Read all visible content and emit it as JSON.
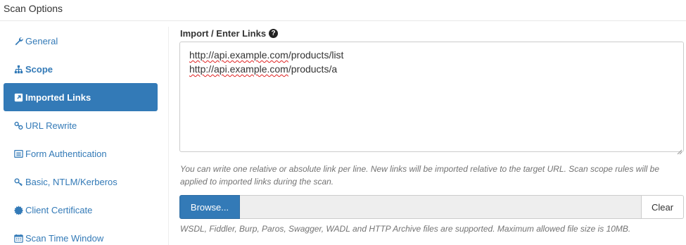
{
  "header": {
    "title": "Scan Options"
  },
  "sidebar": {
    "items": [
      {
        "label": "General",
        "icon": "wrench-icon"
      },
      {
        "label": "Scope",
        "icon": "sitemap-icon"
      },
      {
        "label": "Imported Links",
        "icon": "external-link-icon"
      },
      {
        "label": "URL Rewrite",
        "icon": "link-icon"
      },
      {
        "label": "Form Authentication",
        "icon": "list-alt-icon"
      },
      {
        "label": "Basic, NTLM/Kerberos",
        "icon": "key-icon"
      },
      {
        "label": "Client Certificate",
        "icon": "certificate-icon"
      },
      {
        "label": "Scan Time Window",
        "icon": "calendar-icon"
      }
    ],
    "active_index": 2
  },
  "main": {
    "field_label": "Import / Enter Links",
    "links": [
      {
        "host": "http://api.example.com",
        "path": "/products/list"
      },
      {
        "host": "http://api.example.com",
        "path": "/products/a"
      }
    ],
    "help_text": "You can write one relative or absolute link per line. New links will be imported relative to the target URL. Scan scope rules will be applied to imported links during the scan.",
    "browse_label": "Browse...",
    "clear_label": "Clear",
    "file_note": "WSDL, Fiddler, Burp, Paros, Swagger, WADL and HTTP Archive files are supported. Maximum allowed file size is 10MB."
  },
  "colors": {
    "accent": "#337ab7",
    "help_text": "#737373",
    "file_display_bg": "#eeeeee"
  }
}
